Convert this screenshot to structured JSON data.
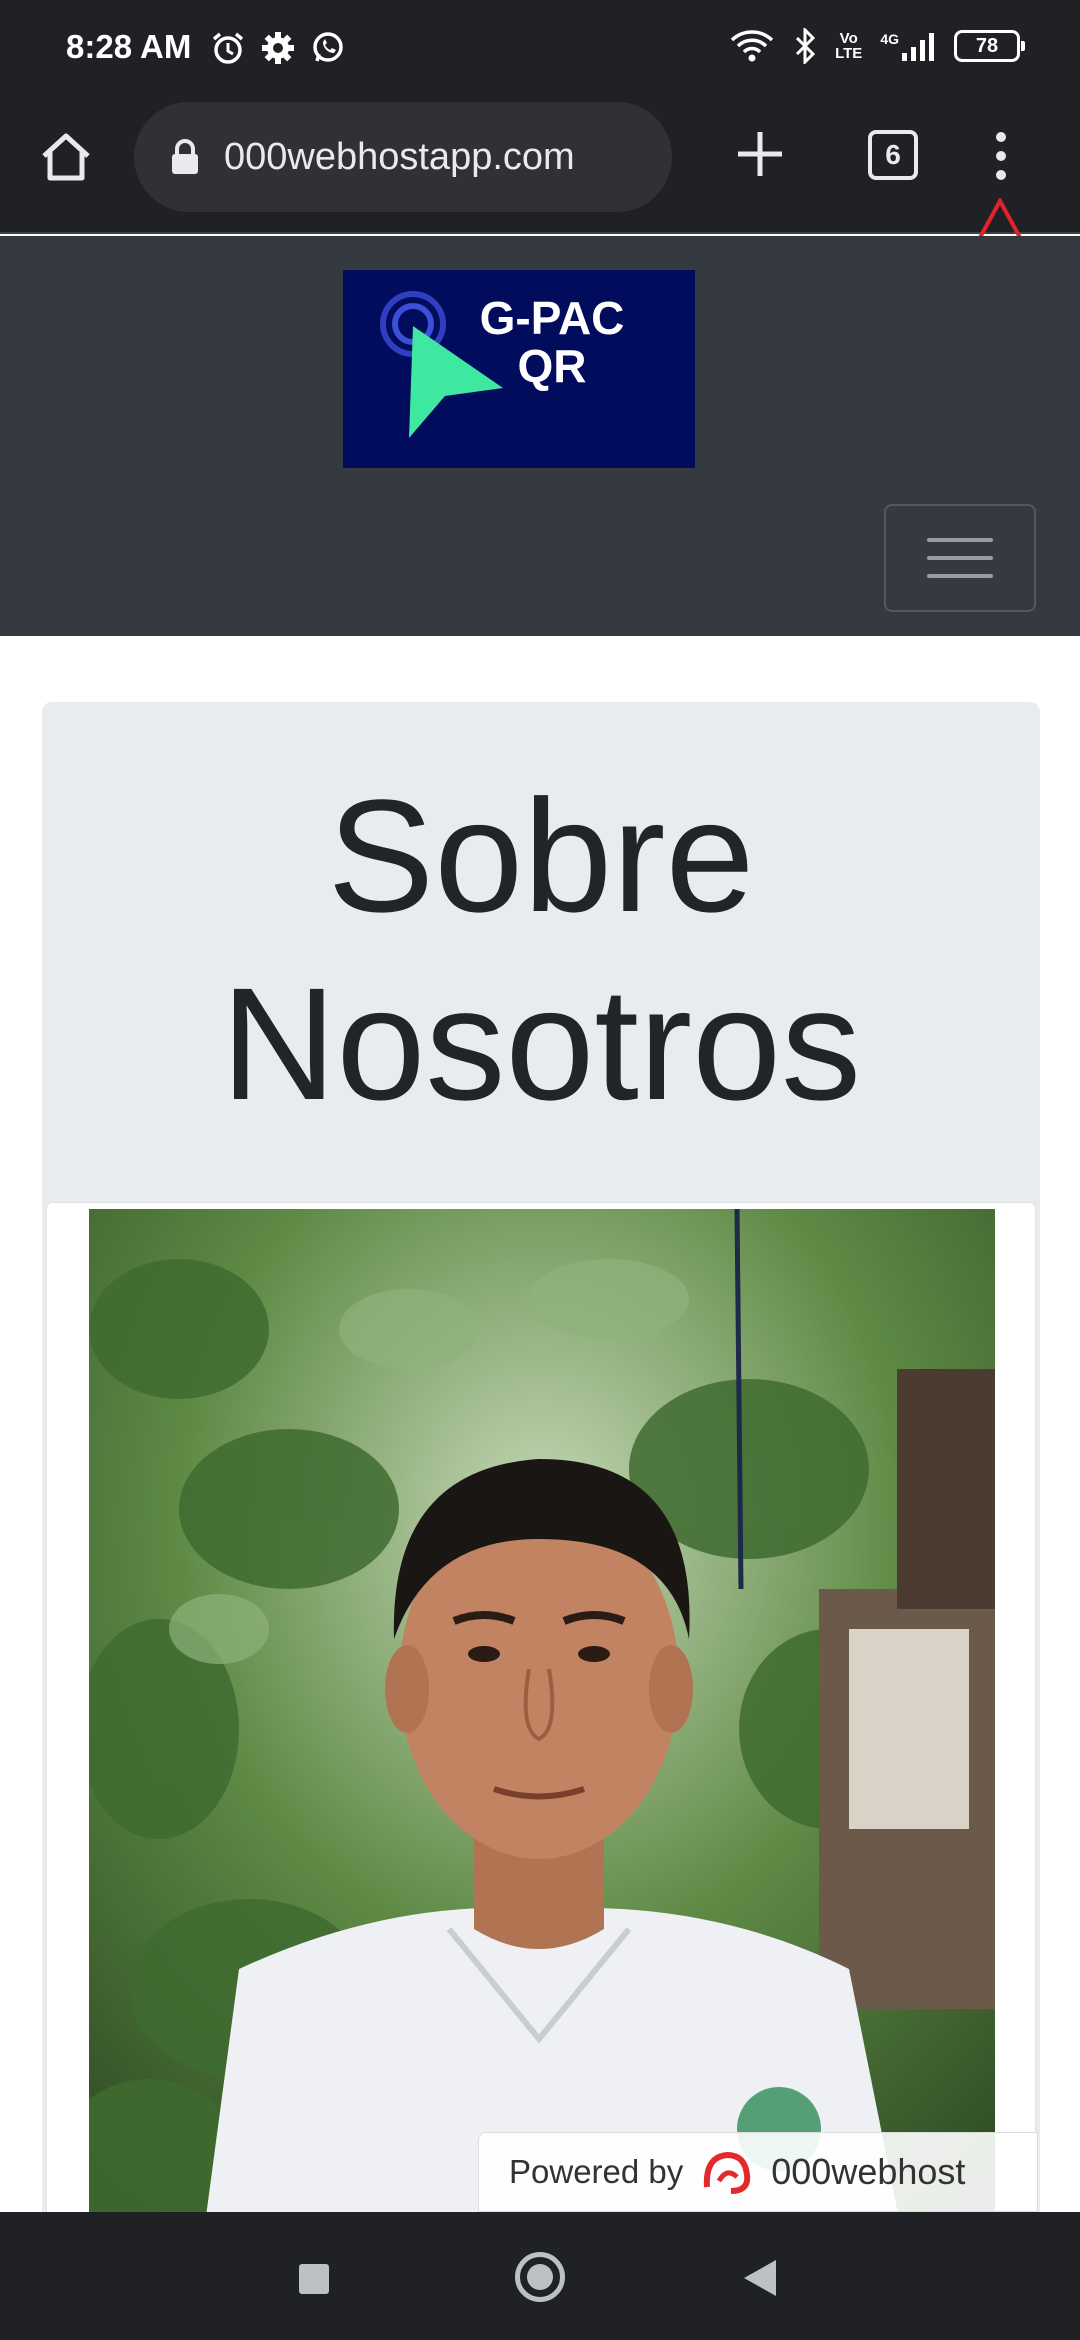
{
  "status_bar": {
    "time": "8:28 AM",
    "left_icons": [
      "alarm-icon",
      "gear-icon",
      "whatsapp-icon"
    ],
    "right_icons": [
      "wifi-icon",
      "bluetooth-icon",
      "volte-icon",
      "signal-icon"
    ],
    "volte_top": "Vo",
    "volte_bottom": "LTE",
    "network": "4G",
    "battery": "78"
  },
  "browser": {
    "url": "000webhostapp.com",
    "tab_count": "6"
  },
  "site": {
    "logo_text_line1": "G-PAC",
    "logo_text_line2": "QR",
    "colors": {
      "navbar": "#343a40",
      "logo_bg": "#020c5c",
      "logo_accent": "#3ee8a0"
    }
  },
  "main": {
    "title_line1": "Sobre",
    "title_line2": "Nosotros"
  },
  "badge": {
    "label": "Powered by",
    "brand": "000webhost"
  }
}
